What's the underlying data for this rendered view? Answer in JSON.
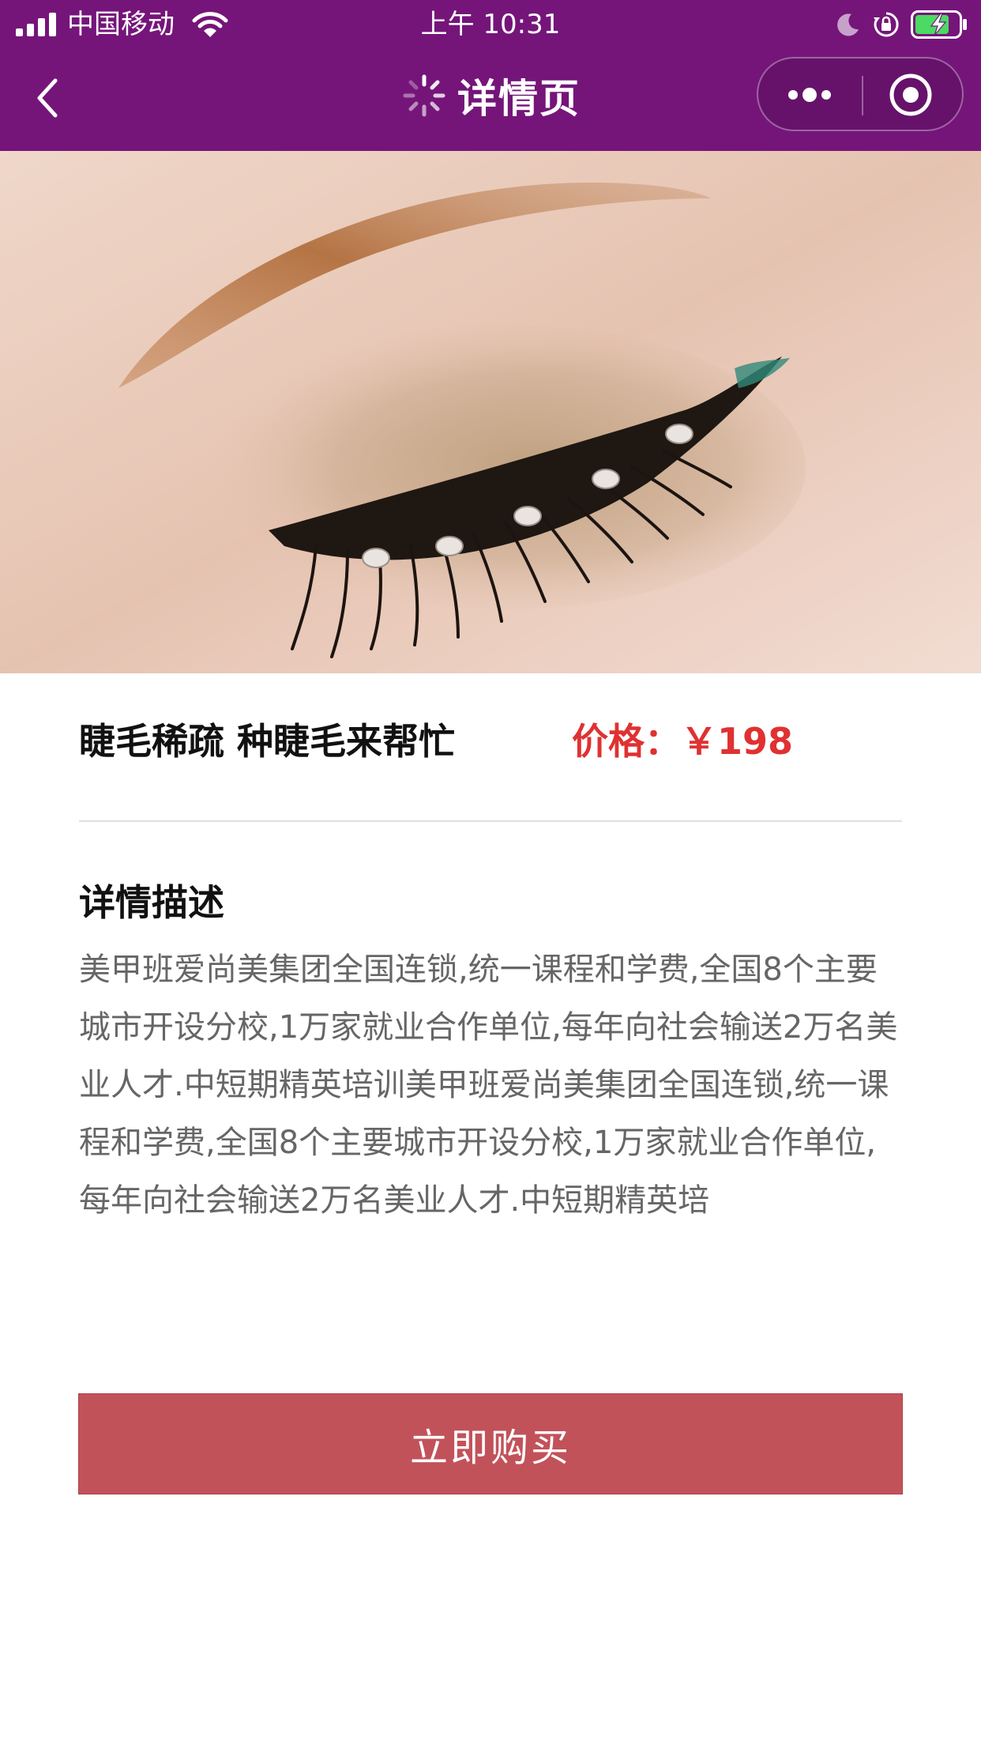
{
  "status_bar": {
    "carrier": "中国移动",
    "time": "上午 10:31"
  },
  "nav": {
    "title": "详情页",
    "icons": [
      "back-icon",
      "spinner-icon",
      "more-icon",
      "close-icon"
    ]
  },
  "hero": {
    "image": "eye-lash-photo"
  },
  "product": {
    "name": "睫毛稀疏 种睫毛来帮忙",
    "price": "价格：￥198"
  },
  "description": {
    "heading": "详情描述",
    "body": "美甲班爱尚美集团全国连锁,统一课程和学费,全国8个主要城市开设分校,1万家就业合作单位,每年向社会输送2万名美业人才.中短期精英培训美甲班爱尚美集团全国连锁,统一课程和学费,全国8个主要城市开设分校,1万家就业合作单位,每年向社会输送2万名美业人才.中短期精英培"
  },
  "actions": {
    "buy_label": "立即购买"
  },
  "colors": {
    "header_bg": "#75157a",
    "price": "#e03131",
    "buy_button": "#c2525a"
  }
}
